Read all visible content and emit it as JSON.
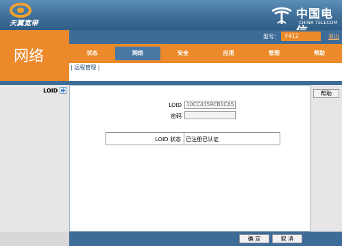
{
  "brand": {
    "name": "天翼宽带",
    "icon": "tianyi-logo-icon"
  },
  "carrier": {
    "name_cn": "中国电信",
    "name_en": "CHINA TELECOM",
    "icon": "china-telecom-logo-icon"
  },
  "page_title": "网络",
  "model": {
    "label": "型号：",
    "value": "F412"
  },
  "logout_label": "退出",
  "tabs": [
    {
      "label": "状态",
      "active": false
    },
    {
      "label": "网络",
      "active": true
    },
    {
      "label": "安全",
      "active": false
    },
    {
      "label": "应用",
      "active": false
    },
    {
      "label": "管理",
      "active": false
    },
    {
      "label": "帮助",
      "active": false
    }
  ],
  "subnav": {
    "item": "| 远程管理 |"
  },
  "sidebar": {
    "item": "LOID",
    "icon": "arrow-right-icon"
  },
  "help_button": "帮助",
  "form": {
    "loid_label": "LOID",
    "loid_value": "10CC4359CB1CA5",
    "password_label": "密码",
    "password_value": ""
  },
  "status": {
    "label": "LOID 状态",
    "value": "已注册已认证"
  },
  "footer": {
    "confirm": "确 定",
    "cancel": "取 消"
  },
  "colors": {
    "orange": "#ec8a2b",
    "blue": "#3e6c98",
    "panel": "#e6e6e6"
  }
}
